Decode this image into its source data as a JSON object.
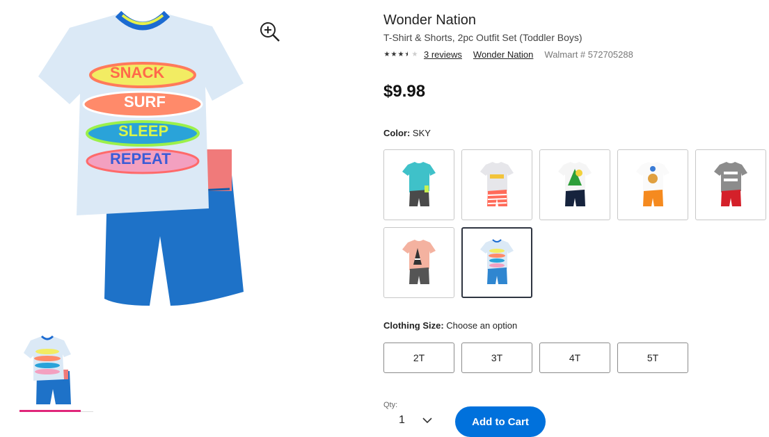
{
  "product": {
    "brand": "Wonder Nation",
    "name": "T-Shirt & Shorts, 2pc Outfit Set (Toddler Boys)",
    "rating": 3.5,
    "reviews_label": "3 reviews",
    "brand_link": "Wonder Nation",
    "walmart_number": "Walmart # 572705288",
    "price": "$9.98"
  },
  "gallery": {
    "main_image_text": [
      "SNACK",
      "SURF",
      "SLEEP",
      "REPEAT"
    ],
    "zoom_icon": "zoom-in-icon",
    "thumbnail_selected": true
  },
  "color": {
    "label": "Color:",
    "selected": "SKY",
    "swatches": [
      {
        "name": "tie-dye-teal",
        "shirt": "#3fc1c9",
        "shorts": "#4a4a4a"
      },
      {
        "name": "grey-red-stripe",
        "shirt": "#e6e6ea",
        "shorts": "#ff6b5a"
      },
      {
        "name": "tropical-navy",
        "shirt": "#f5f5f5",
        "shorts": "#16233d"
      },
      {
        "name": "lion-orange",
        "shirt": "#fafafa",
        "shorts": "#f58a1f"
      },
      {
        "name": "grey-red",
        "shirt": "#8c8c8c",
        "shorts": "#d4202a"
      },
      {
        "name": "pink-zebra",
        "shirt": "#f4b2a0",
        "shorts": "#555555"
      },
      {
        "name": "sky",
        "shirt": "#dbe9f6",
        "shorts": "#2f86d0"
      }
    ],
    "selected_index": 6
  },
  "size": {
    "label": "Clothing Size:",
    "prompt": "Choose an option",
    "options": [
      "2T",
      "3T",
      "4T",
      "5T"
    ]
  },
  "quantity": {
    "label": "Qty:",
    "value": "1"
  },
  "cart": {
    "button_label": "Add to Cart",
    "accent": "#0071dc"
  }
}
